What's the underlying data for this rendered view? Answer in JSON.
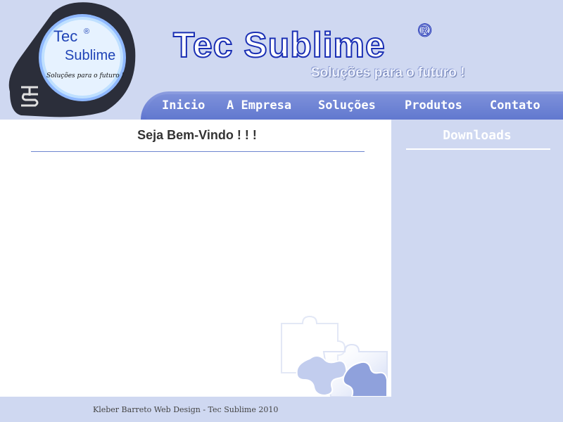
{
  "logo": {
    "title_line1": "Tec",
    "title_line2": "Sublime",
    "reg_mark": "®",
    "slogan": "Soluções para o futuro !"
  },
  "header": {
    "title": "Tec Sublime",
    "reg_mark": "®",
    "slogan": "Soluções para o futuro !"
  },
  "nav": {
    "items": [
      "Inicio",
      "A Empresa",
      "Soluções",
      "Produtos",
      "Contato"
    ]
  },
  "main": {
    "welcome": "Seja Bem-Vindo ! ! !"
  },
  "sidebar": {
    "title": "Downloads"
  },
  "footer": {
    "text": "Kleber Barreto Web Design - Tec Sublime 2010"
  },
  "colors": {
    "background": "#cfd8f1",
    "nav": "#6178cf",
    "title_stroke": "#1a2fb4"
  }
}
